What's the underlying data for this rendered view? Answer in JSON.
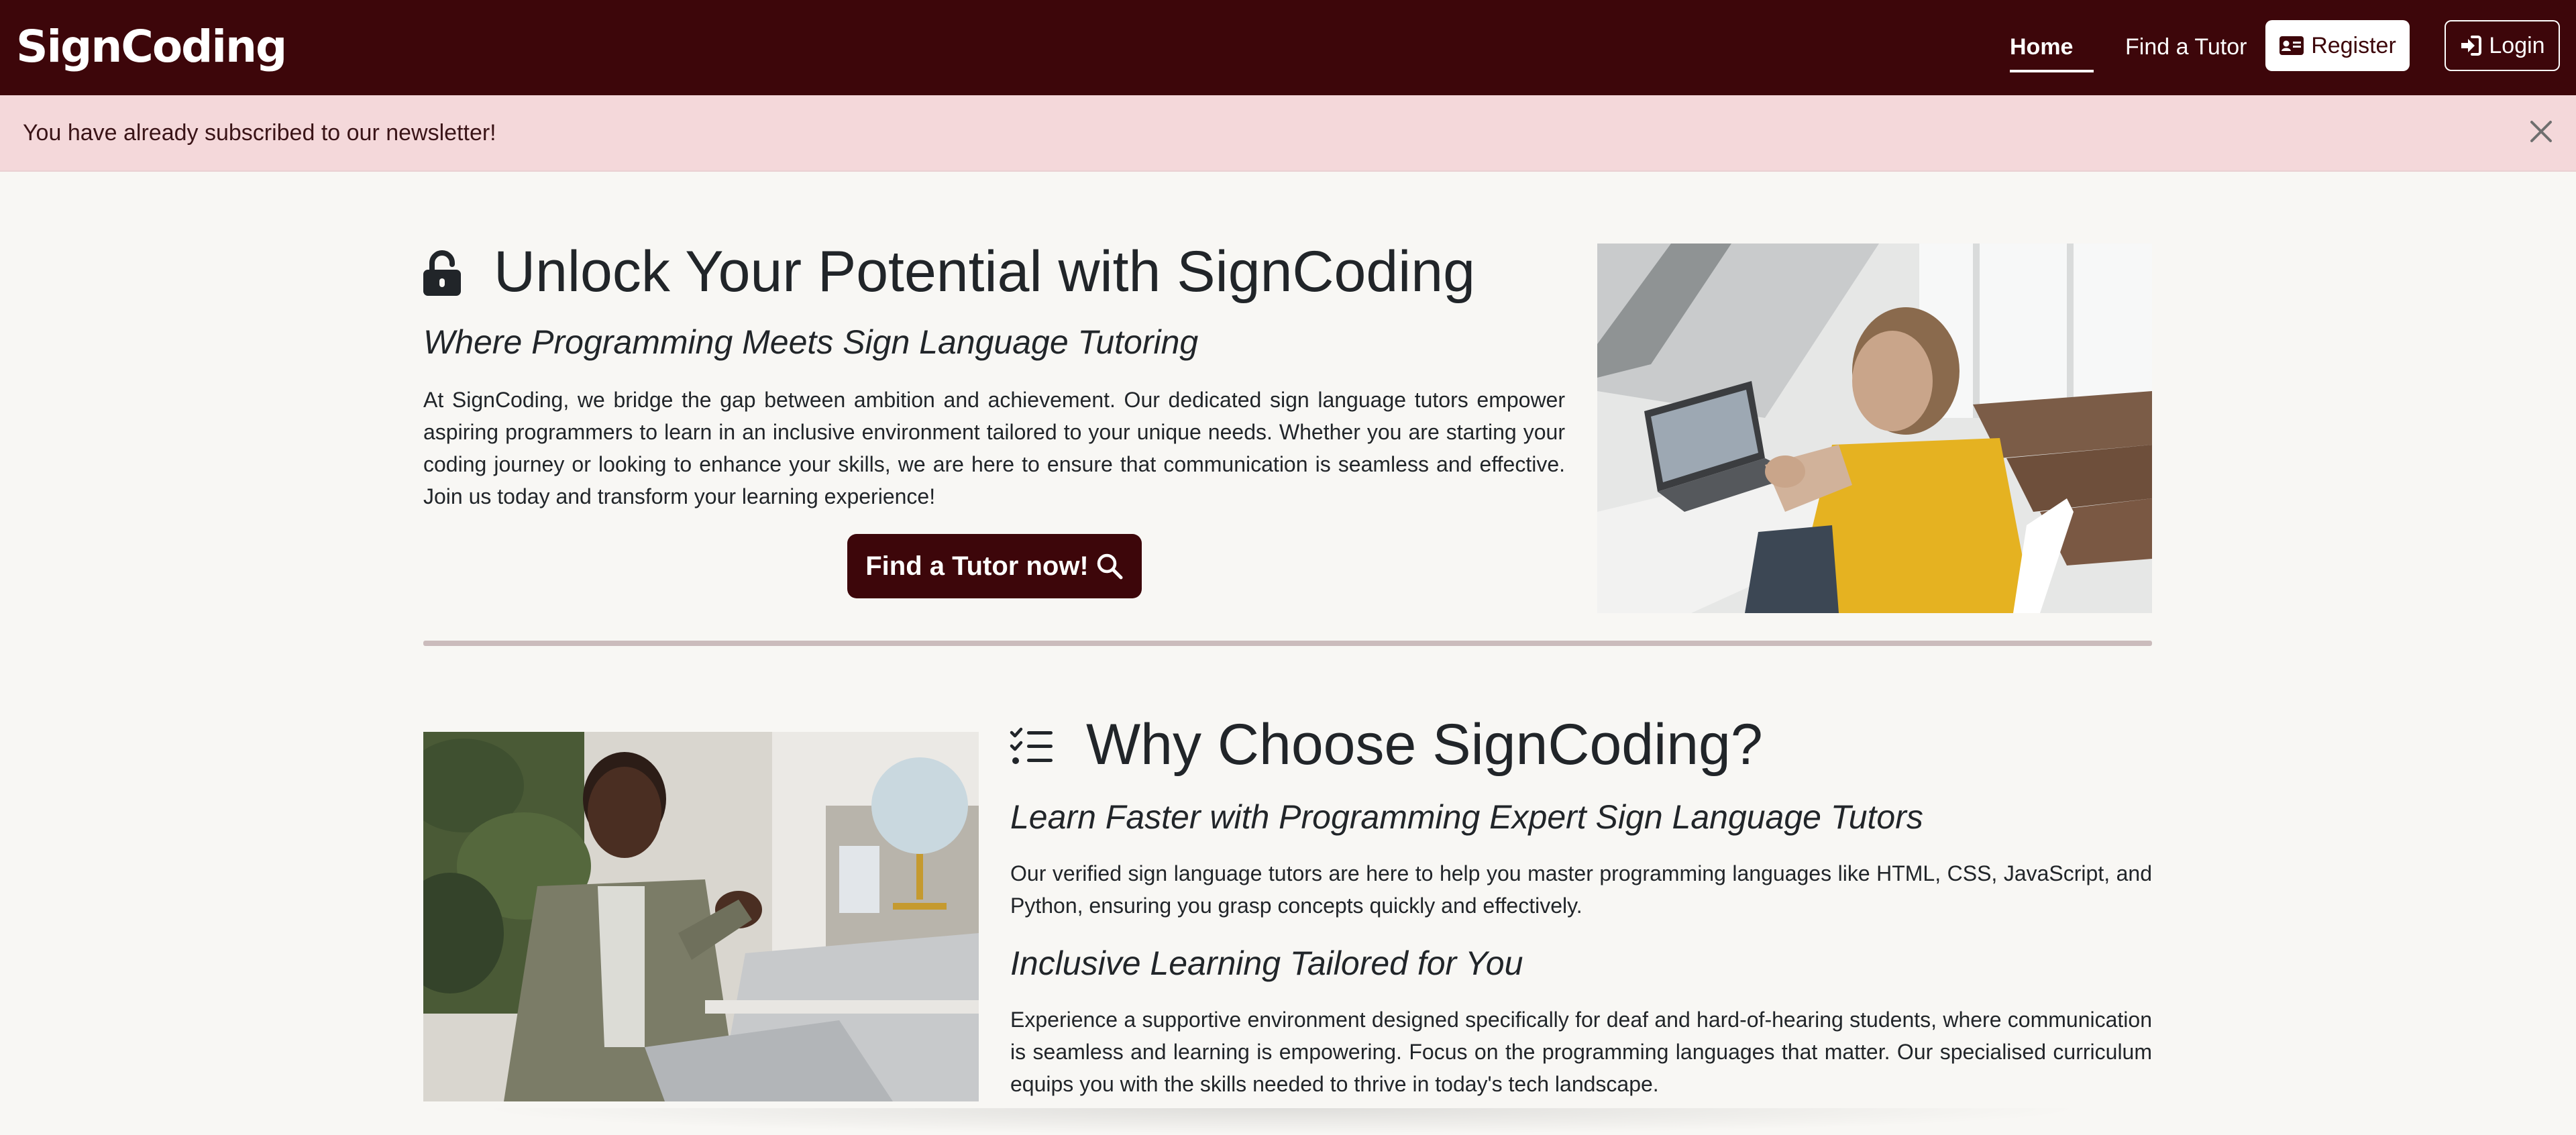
{
  "navbar": {
    "brand": "SignCoding",
    "links": {
      "home": "Home",
      "find_tutor": "Find a Tutor",
      "register": "Register",
      "login": "Login"
    },
    "icons": {
      "register": "id-card-icon",
      "login": "sign-in-icon"
    },
    "background_color": "#3d060a"
  },
  "alert": {
    "message": "You have already subscribed to our newsletter!",
    "close_icon": "close-icon",
    "background_color": "#f4d8da"
  },
  "hero": {
    "icon": "unlock-icon",
    "title": "Unlock Your Potential with SignCoding",
    "subtitle": "Where Programming Meets Sign Language Tutoring",
    "paragraph": "At SignCoding, we bridge the gap between ambition and achievement. Our dedicated sign language tutors empower aspiring programmers to learn in an inclusive environment tailored to your unique needs. Whether you are starting your coding journey or looking to enhance your skills, we are here to ensure that communication is seamless and effective. Join us today and transform your learning experience!",
    "cta_label": "Find a Tutor now!",
    "cta_icon": "search-icon"
  },
  "why": {
    "icon": "list-check-icon",
    "title": "Why Choose SignCoding?",
    "subtitle1": "Learn Faster with Programming Expert Sign Language Tutors",
    "paragraph1": "Our verified sign language tutors are here to help you master programming languages like HTML, CSS, JavaScript, and Python, ensuring you grasp concepts quickly and effectively.",
    "subtitle2": "Inclusive Learning Tailored for You",
    "paragraph2": "Experience a supportive environment designed specifically for deaf and hard-of-hearing students, where communication is seamless and learning is empowering. Focus on the programming languages that matter. Our specialised curriculum equips you with the skills needed to thrive in today's tech landscape."
  }
}
